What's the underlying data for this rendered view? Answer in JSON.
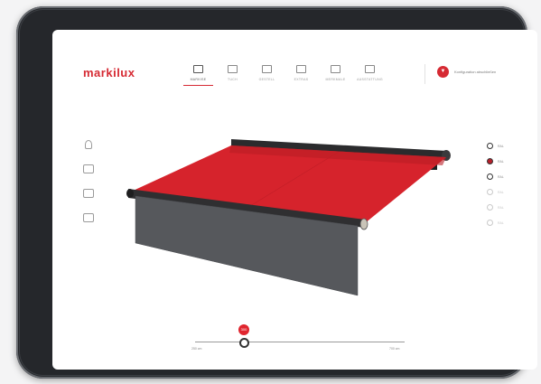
{
  "brand": {
    "logo_text": "markilux",
    "accent": "#d62a33"
  },
  "nav": {
    "tabs": [
      {
        "label": "MARKISE",
        "icon": "awning-icon",
        "active": true
      },
      {
        "label": "TUCH",
        "icon": "fabric-icon",
        "active": false
      },
      {
        "label": "GESTELL",
        "icon": "frame-icon",
        "active": false
      },
      {
        "label": "EXTRAS",
        "icon": "extras-icon",
        "active": false
      },
      {
        "label": "MERKMALE",
        "icon": "features-icon",
        "active": false
      },
      {
        "label": "AUSSTATTUNG",
        "icon": "equipment-icon",
        "active": false
      }
    ]
  },
  "action": {
    "label": "Konfiguration abschließen",
    "icon": "filter-icon"
  },
  "side_tools": [
    "person-icon",
    "camera-icon",
    "awning-side-icon",
    "awning-front-icon"
  ],
  "swatches": [
    {
      "label": "RAL",
      "color": "#333333",
      "state": "dark"
    },
    {
      "label": "RAL",
      "color": "#b81f2a",
      "state": "selected"
    },
    {
      "label": "RAL",
      "color": "#333333",
      "state": "dark"
    },
    {
      "label": "RAL",
      "color": "#c9c9c9",
      "state": "light"
    },
    {
      "label": "RAL",
      "color": "#c9c9c9",
      "state": "light"
    },
    {
      "label": "RAL",
      "color": "#c9c9c9",
      "state": "light"
    }
  ],
  "slider": {
    "min_label": "250 cm",
    "max_label": "700 cm",
    "value": "300",
    "fraction": 0.22
  }
}
